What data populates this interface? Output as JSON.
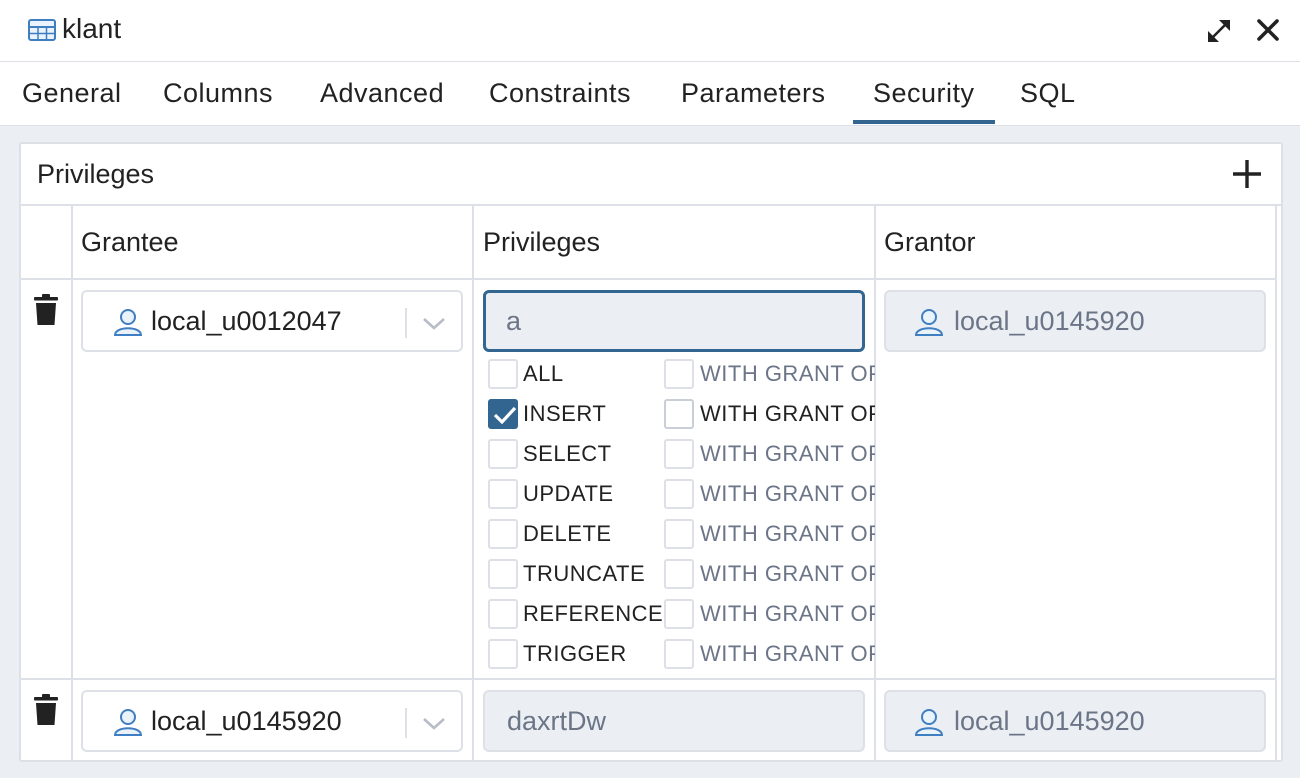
{
  "window": {
    "title": "klant"
  },
  "tabs": [
    {
      "label": "General"
    },
    {
      "label": "Columns"
    },
    {
      "label": "Advanced"
    },
    {
      "label": "Constraints"
    },
    {
      "label": "Parameters"
    },
    {
      "label": "Security",
      "active": true
    },
    {
      "label": "SQL"
    }
  ],
  "privileges_panel": {
    "title": "Privileges",
    "columns": {
      "grantee": "Grantee",
      "privileges": "Privileges",
      "grantor": "Grantor"
    },
    "rows": [
      {
        "grantee": "local_u0012047",
        "privileges_value": "a",
        "grantor": "local_u0145920",
        "options": [
          {
            "label": "ALL",
            "checked": false,
            "grant_label": "WITH GRANT OPTION",
            "grant_checked": false,
            "grant_enabled": false
          },
          {
            "label": "INSERT",
            "checked": true,
            "grant_label": "WITH GRANT OPTION",
            "grant_checked": false,
            "grant_enabled": true
          },
          {
            "label": "SELECT",
            "checked": false,
            "grant_label": "WITH GRANT OPTION",
            "grant_checked": false,
            "grant_enabled": false
          },
          {
            "label": "UPDATE",
            "checked": false,
            "grant_label": "WITH GRANT OPTION",
            "grant_checked": false,
            "grant_enabled": false
          },
          {
            "label": "DELETE",
            "checked": false,
            "grant_label": "WITH GRANT OPTION",
            "grant_checked": false,
            "grant_enabled": false
          },
          {
            "label": "TRUNCATE",
            "checked": false,
            "grant_label": "WITH GRANT OPTION",
            "grant_checked": false,
            "grant_enabled": false
          },
          {
            "label": "REFERENCES",
            "checked": false,
            "grant_label": "WITH GRANT OPTION",
            "grant_checked": false,
            "grant_enabled": false
          },
          {
            "label": "TRIGGER",
            "checked": false,
            "grant_label": "WITH GRANT OPTION",
            "grant_checked": false,
            "grant_enabled": false
          }
        ]
      },
      {
        "grantee": "local_u0145920",
        "privileges_value": "daxrtDw",
        "grantor": "local_u0145920"
      }
    ]
  },
  "icons": {
    "title": "table-icon",
    "expand": "expand-icon",
    "close": "close-icon",
    "add": "plus-icon",
    "delete": "trash-icon",
    "user": "user-icon",
    "dropdown": "chevron-down-icon"
  },
  "colors": {
    "accent": "#326690",
    "icon_blue": "#3f7fc1",
    "border": "#dde0e6",
    "muted_text": "#6b7587",
    "background": "#ebeef3"
  }
}
